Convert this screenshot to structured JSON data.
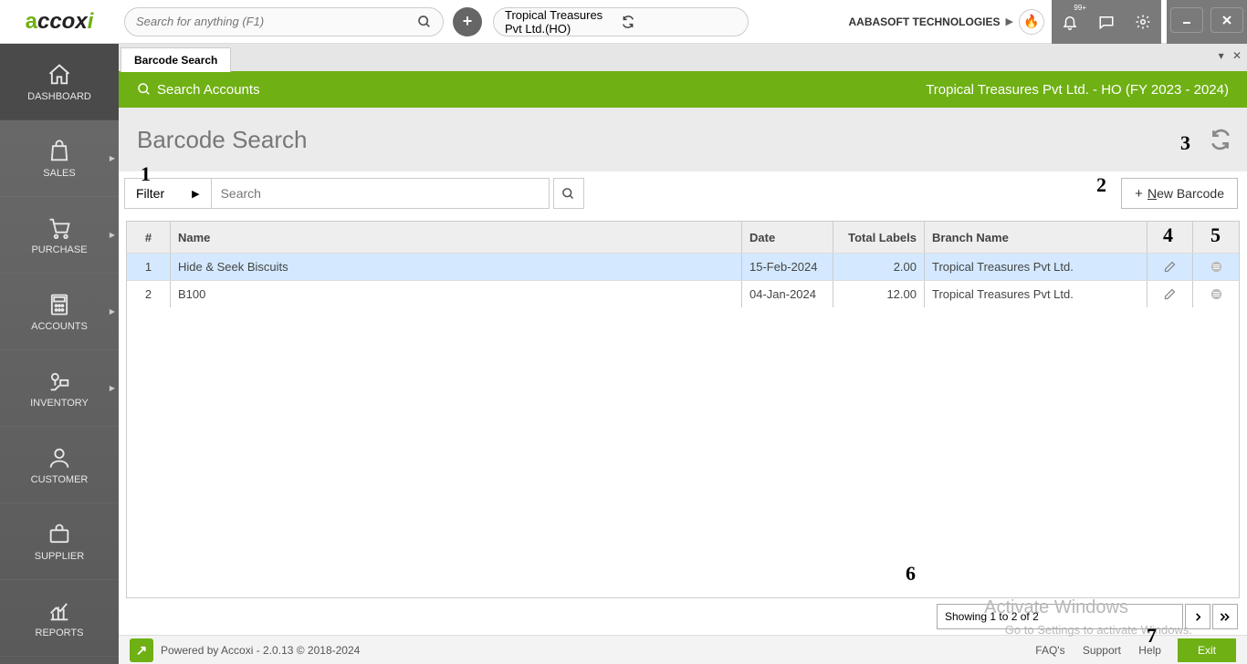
{
  "header": {
    "search_placeholder": "Search for anything (F1)",
    "org_name": "Tropical Treasures Pvt Ltd.(HO)",
    "user_company": "AABASOFT TECHNOLOGIES",
    "notif_badge": "99+"
  },
  "sidebar": {
    "items": [
      {
        "label": "DASHBOARD"
      },
      {
        "label": "SALES"
      },
      {
        "label": "PURCHASE"
      },
      {
        "label": "ACCOUNTS"
      },
      {
        "label": "INVENTORY"
      },
      {
        "label": "CUSTOMER"
      },
      {
        "label": "SUPPLIER"
      },
      {
        "label": "REPORTS"
      }
    ]
  },
  "tab": {
    "label": "Barcode Search"
  },
  "greenbar": {
    "search_label": "Search Accounts",
    "context": "Tropical Treasures Pvt Ltd. - HO (FY 2023 - 2024)"
  },
  "page": {
    "title": "Barcode Search",
    "filter_label": "Filter",
    "table_search_placeholder": "Search",
    "new_barcode_prefix": "N",
    "new_barcode_rest": "ew Barcode"
  },
  "table": {
    "headers": {
      "idx": "#",
      "name": "Name",
      "date": "Date",
      "total": "Total Labels",
      "branch": "Branch Name"
    },
    "rows": [
      {
        "idx": "1",
        "name": "Hide & Seek Biscuits",
        "date": "15-Feb-2024",
        "total": "2.00",
        "branch": "Tropical Treasures Pvt Ltd."
      },
      {
        "idx": "2",
        "name": "B100",
        "date": "04-Jan-2024",
        "total": "12.00",
        "branch": "Tropical Treasures Pvt Ltd."
      }
    ]
  },
  "pagination": {
    "info": "Showing 1 to 2 of 2"
  },
  "footer": {
    "powered": "Powered by Accoxi - 2.0.13 © 2018-2024",
    "faqs": "FAQ's",
    "support": "Support",
    "help": "Help",
    "exit": "Exit"
  },
  "watermark": {
    "line1": "Activate Windows",
    "line2": "Go to Settings to activate Windows."
  },
  "annotations": {
    "a1": "1",
    "a2": "2",
    "a3": "3",
    "a4": "4",
    "a5": "5",
    "a6": "6",
    "a7": "7"
  }
}
